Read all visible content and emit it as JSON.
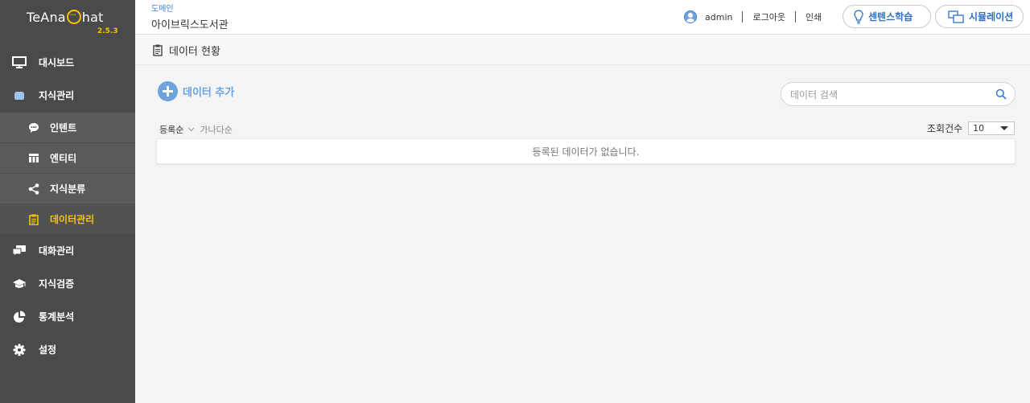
{
  "app": {
    "logo_prefix": "TeAna",
    "logo_suffix": "hat",
    "version": "2.5.3"
  },
  "sidebar": {
    "items": [
      {
        "label": "대시보드",
        "icon": "monitor-icon"
      },
      {
        "label": "지식관리",
        "icon": "cloud-icon"
      },
      {
        "label": "대화관리",
        "icon": "chat-icon"
      },
      {
        "label": "지식검증",
        "icon": "graduation-cap-icon"
      },
      {
        "label": "통계분석",
        "icon": "pie-chart-icon"
      },
      {
        "label": "설정",
        "icon": "gear-icon"
      }
    ],
    "submenu": [
      {
        "label": "인텐트",
        "icon": "speech-bubble-icon"
      },
      {
        "label": "엔티티",
        "icon": "grid-icon"
      },
      {
        "label": "지식분류",
        "icon": "share-icon"
      },
      {
        "label": "데이터관리",
        "icon": "clipboard-icon"
      }
    ],
    "active_color": "#f5c400"
  },
  "header": {
    "domain_label": "도메인",
    "domain_name": "아이브릭스도서관",
    "username": "admin",
    "logout": "로그아웃",
    "print": "인쇄",
    "learn_button": "센텐스학습",
    "simulation_button": "시뮬레이션"
  },
  "page": {
    "title": "데이터 현황",
    "add_label": "데이터 추가",
    "search_placeholder": "데이터 검색",
    "sort_primary": "등록순",
    "sort_secondary": "가나다순",
    "count_label": "조회건수",
    "count_value": "10",
    "empty_message": "등록된 데이터가 없습니다."
  },
  "colors": {
    "sidebar_bg": "#4a4a4a",
    "accent_blue": "#3d7fd6",
    "add_blue": "#6fa3dc"
  }
}
